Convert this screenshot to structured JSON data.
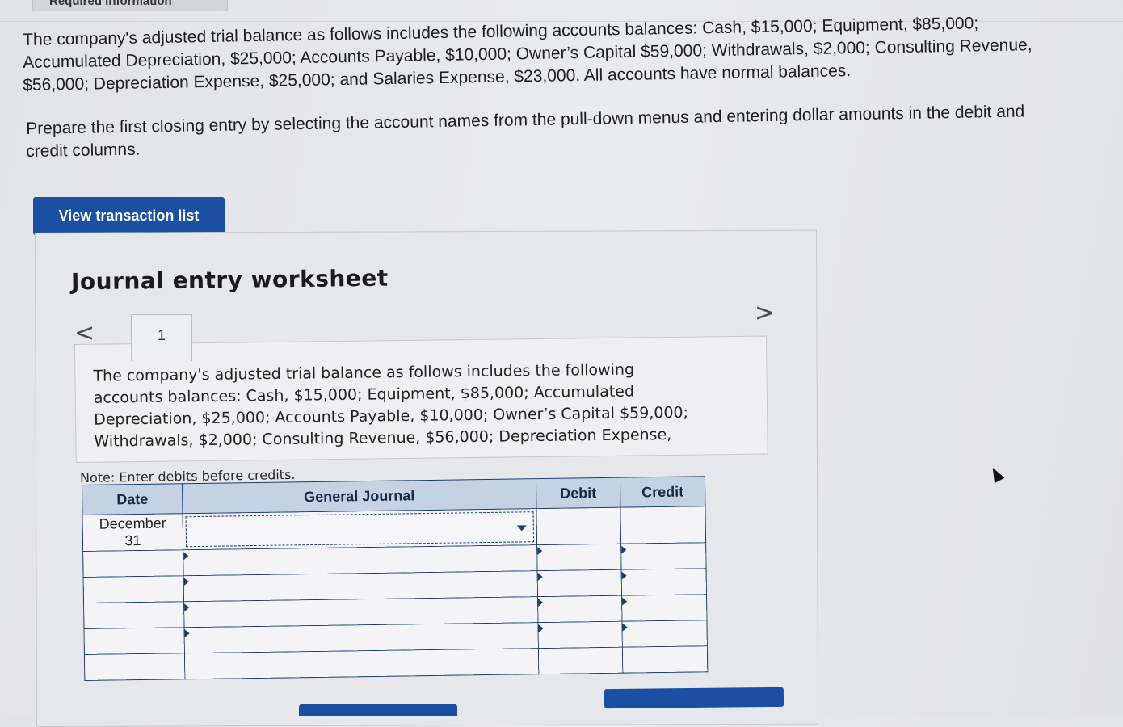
{
  "header": {
    "cut_tab_label": "Required information"
  },
  "question": {
    "paragraph1_lines": [
      "The company's adjusted trial balance as follows includes the following accounts balances: Cash, $15,000; Equipment, $85,000;",
      "Accumulated Depreciation, $25,000; Accounts Payable, $10,000; Owner’s Capital $59,000; Withdrawals, $2,000; Consulting Revenue,",
      "$56,000; Depreciation Expense, $25,000; and Salaries Expense, $23,000. All accounts have normal balances."
    ],
    "paragraph2_lines": [
      "Prepare the first closing entry by selecting the account names from the pull-down menus and entering dollar amounts in the debit and",
      "credit columns."
    ]
  },
  "actions": {
    "view_transaction_list": "View transaction list"
  },
  "worksheet": {
    "title": "Journal entry worksheet",
    "prev_arrow": "<",
    "next_arrow": ">",
    "current_tab": "1",
    "description_lines": [
      "The company's adjusted trial balance as follows includes the following",
      "accounts balances: Cash, $15,000; Equipment, $85,000; Accumulated",
      "Depreciation, $25,000; Accounts Payable, $10,000; Owner’s Capital $59,000;",
      "Withdrawals, $2,000; Consulting Revenue, $56,000; Depreciation Expense,"
    ],
    "note": "Note: Enter debits before credits.",
    "columns": {
      "date": "Date",
      "general_journal": "General Journal",
      "debit": "Debit",
      "credit": "Credit"
    },
    "entry_date": {
      "month": "December",
      "day": "31"
    }
  }
}
